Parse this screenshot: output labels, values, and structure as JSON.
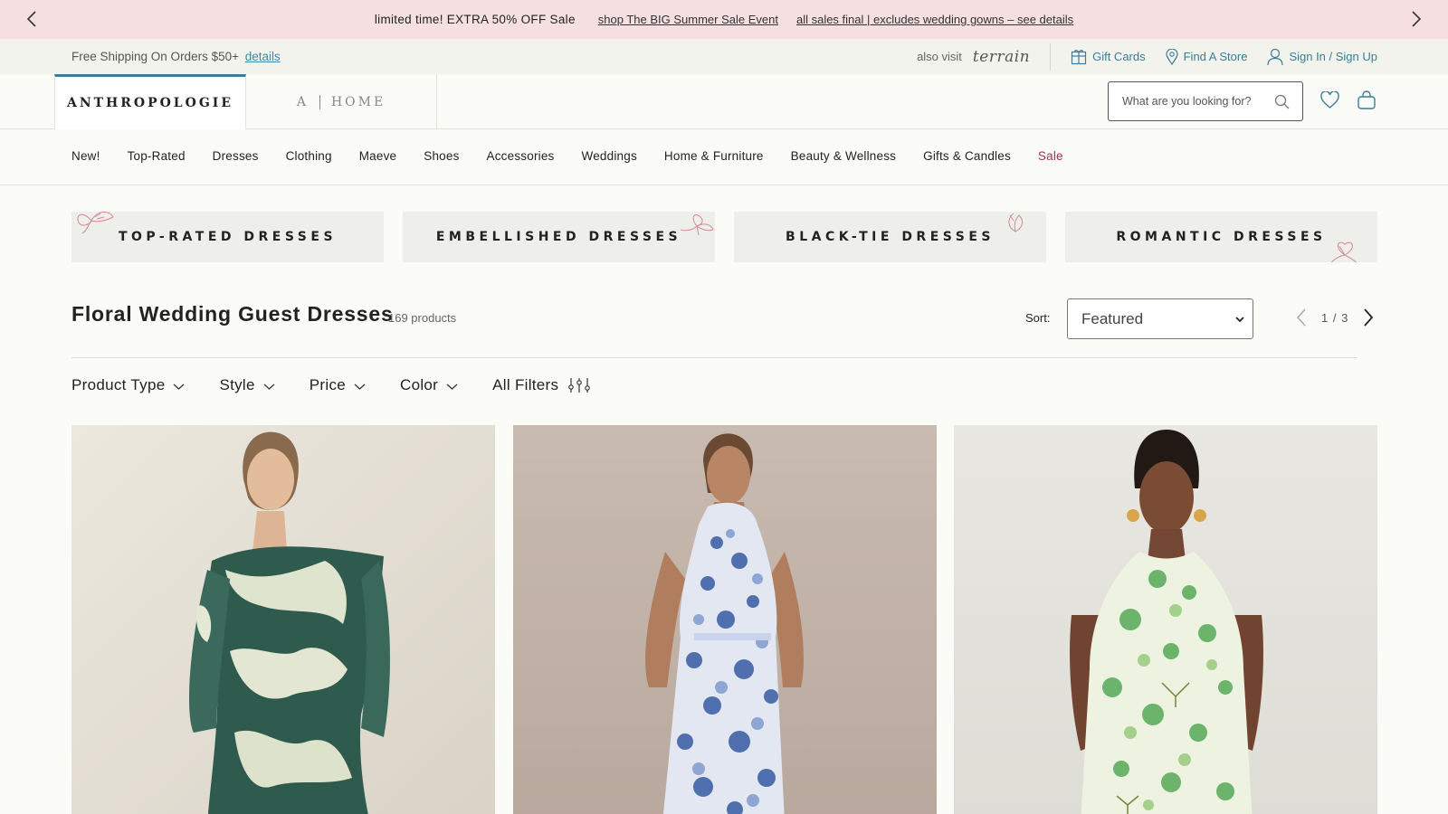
{
  "promo": {
    "message": "limited time! EXTRA 50% OFF Sale",
    "link1": "shop The BIG Summer Sale Event",
    "link2": "all sales final | excludes wedding gowns – see details"
  },
  "utility": {
    "shipping_text": "Free Shipping On Orders $50+",
    "shipping_link": "details",
    "also_visit": "also visit",
    "terrain": "terrain",
    "gift_cards": "Gift Cards",
    "find_store": "Find A Store",
    "sign_in": "Sign In / Sign Up"
  },
  "header": {
    "logo": "ANTHROPOLOGIE",
    "home_logo_a": "A",
    "home_logo_word": "HOME",
    "search_placeholder": "What are you looking for?"
  },
  "nav": {
    "items": [
      "New!",
      "Top-Rated",
      "Dresses",
      "Clothing",
      "Maeve",
      "Shoes",
      "Accessories",
      "Weddings",
      "Home & Furniture",
      "Beauty & Wellness",
      "Gifts & Candles",
      "Sale"
    ]
  },
  "tiles": [
    "TOP-RATED DRESSES",
    "EMBELLISHED DRESSES",
    "BLACK-TIE DRESSES",
    "ROMANTIC DRESSES"
  ],
  "listing": {
    "title": "Floral Wedding Guest Dresses",
    "count": "169 products",
    "sort_label": "Sort:",
    "sort_value": "Featured",
    "page_current": "1",
    "page_total": "3",
    "page_text": "1 / 3"
  },
  "filters": [
    "Product Type",
    "Style",
    "Price",
    "Color",
    "All Filters"
  ],
  "colors": {
    "promo_bg": "#f6dfe1",
    "link_blue": "#3a7d97",
    "sale_red": "#a3344a",
    "tile_bg": "#eeeeeb"
  },
  "products": [
    {
      "icon": "product-image-green-abstract-off-shoulder-dress"
    },
    {
      "icon": "product-image-blue-floral-halter-dress"
    },
    {
      "icon": "product-image-green-floral-halter-dress"
    }
  ]
}
